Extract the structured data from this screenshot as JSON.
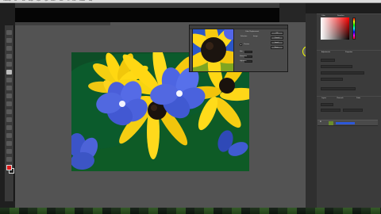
{
  "menubar": {
    "items": [
      "Photoshop",
      "File",
      "Edit",
      "Image",
      "Layer",
      "Type",
      "Select",
      "Filter",
      "3D",
      "View",
      "Window",
      "Help"
    ]
  },
  "dialog": {
    "title": "",
    "labels": [
      "Color Replacement",
      "Selection",
      "Image",
      "Preview",
      "Hue",
      "Saturation",
      "Lightness"
    ],
    "buttons": [
      "OK",
      "Cancel",
      "Load...",
      "Save..."
    ],
    "preview_checked": true
  },
  "panels": {
    "tabs": [
      "Color",
      "Swatches",
      "Adjustments",
      "Properties",
      "Layers",
      "Channels",
      "Paths"
    ],
    "layer_name": "Background"
  },
  "colors": {
    "accent": "#2d58d8",
    "brush_ring": "#f5ff00",
    "foreground": "#e01a1a"
  },
  "icons": {
    "fg_swatch": "color-swatch-icon",
    "tool": "brush-icon",
    "target": "circle-target-icon"
  }
}
